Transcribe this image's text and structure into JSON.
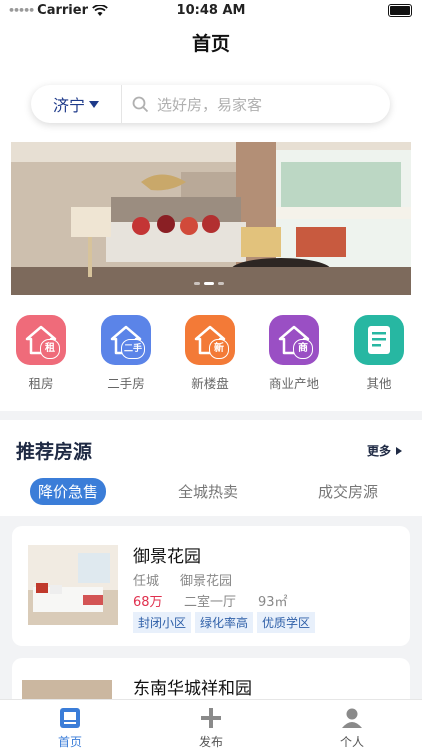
{
  "status": {
    "carrier": "Carrier",
    "time": "10:48 AM"
  },
  "nav": {
    "title": "首页"
  },
  "search": {
    "city": "济宁",
    "placeholder": "选好房，易家客"
  },
  "categories": [
    {
      "label": "租房",
      "badge": "租",
      "color": "#ef6b7a"
    },
    {
      "label": "二手房",
      "badge": "二手",
      "color": "#5b84e8"
    },
    {
      "label": "新楼盘",
      "badge": "新",
      "color": "#f37a37"
    },
    {
      "label": "商业产地",
      "badge": "商",
      "color": "#9a4fc4"
    },
    {
      "label": "其他",
      "badge": "",
      "color": "#27b7a2"
    }
  ],
  "recommend": {
    "title": "推荐房源",
    "more": "更多",
    "tabs": [
      "降价急售",
      "全城热卖",
      "成交房源"
    ]
  },
  "listings": [
    {
      "name": "御景花园",
      "district": "任城",
      "community": "御景花园",
      "price": "68万",
      "layout": "二室一厅",
      "area": "93㎡",
      "tags": [
        "封闭小区",
        "绿化率高",
        "优质学区"
      ]
    },
    {
      "name": "东南华城祥和园"
    }
  ],
  "tabbar": [
    "首页",
    "发布",
    "个人"
  ]
}
